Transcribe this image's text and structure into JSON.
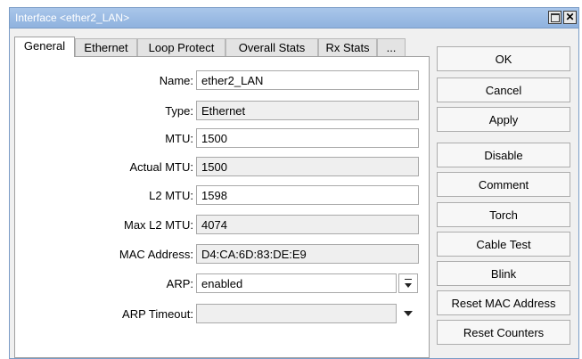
{
  "window": {
    "title": "Interface <ether2_LAN>"
  },
  "tabs": [
    {
      "label": "General"
    },
    {
      "label": "Ethernet"
    },
    {
      "label": "Loop Protect"
    },
    {
      "label": "Overall Stats"
    },
    {
      "label": "Rx Stats"
    },
    {
      "label": "..."
    }
  ],
  "fields": {
    "name": {
      "label": "Name:",
      "value": "ether2_LAN"
    },
    "type": {
      "label": "Type:",
      "value": "Ethernet"
    },
    "mtu": {
      "label": "MTU:",
      "value": "1500"
    },
    "actual_mtu": {
      "label": "Actual MTU:",
      "value": "1500"
    },
    "l2_mtu": {
      "label": "L2 MTU:",
      "value": "1598"
    },
    "max_l2_mtu": {
      "label": "Max L2 MTU:",
      "value": "4074"
    },
    "mac_address": {
      "label": "MAC Address:",
      "value": "D4:CA:6D:83:DE:E9"
    },
    "arp": {
      "label": "ARP:",
      "value": "enabled"
    },
    "arp_timeout": {
      "label": "ARP Timeout:",
      "value": ""
    }
  },
  "buttons": {
    "ok": "OK",
    "cancel": "Cancel",
    "apply": "Apply",
    "disable": "Disable",
    "comment": "Comment",
    "torch": "Torch",
    "cable_test": "Cable Test",
    "blink": "Blink",
    "reset_mac": "Reset MAC Address",
    "reset_counters": "Reset Counters"
  },
  "colors": {
    "titlebar": "#8fb2de",
    "title_text": "#ffffff",
    "readonly_field": "#efefef"
  }
}
